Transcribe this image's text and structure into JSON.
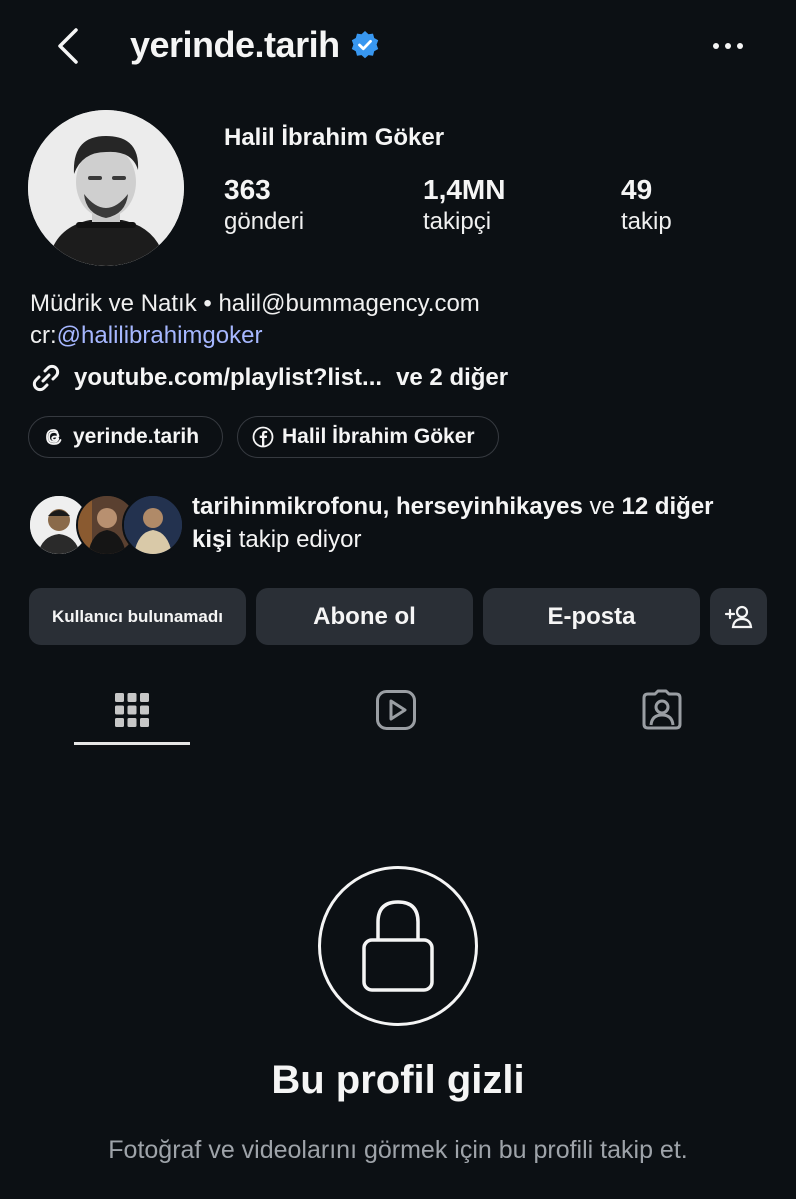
{
  "header": {
    "username": "yerinde.tarih",
    "verified": true,
    "icons": {
      "back": "chevron-left-icon",
      "verified": "verified-badge-icon",
      "more": "more-horizontal-icon"
    }
  },
  "profile": {
    "display_name": "Halil İbrahim Göker",
    "stats": [
      {
        "value": "363",
        "label": "gönderi"
      },
      {
        "value": "1,4MN",
        "label": "takipçi"
      },
      {
        "value": "49",
        "label": "takip"
      }
    ],
    "bio_line1": "Müdrik ve Natık • halil@bummagency.com",
    "bio_prefix": "cr:",
    "bio_mention": "@halilibrahimgoker",
    "link_text": "youtube.com/playlist?list...",
    "link_more": "ve 2 diğer",
    "chips": [
      {
        "icon": "threads-icon",
        "label": "yerinde.tarih"
      },
      {
        "icon": "facebook-icon",
        "label": "Halil İbrahim Göker"
      }
    ]
  },
  "mutual": {
    "names": "tarihinmikrofonu, herseyinhikayes",
    "and_word": " ve ",
    "count_text": "12 diğer",
    "line2_bold": "kişi",
    "line2_rest": " takip ediyor"
  },
  "actions": {
    "user_not_found": "Kullanıcı bulunamadı",
    "subscribe": "Abone ol",
    "email": "E-posta",
    "add_user_icon": "person-add-icon"
  },
  "tabs": [
    {
      "name": "grid",
      "icon": "grid-icon",
      "active": true
    },
    {
      "name": "reels",
      "icon": "reels-play-icon",
      "active": false
    },
    {
      "name": "tagged",
      "icon": "tagged-person-icon",
      "active": false
    }
  ],
  "private": {
    "icon": "lock-icon",
    "title": "Bu profil gizli",
    "subtitle": "Fotoğraf ve videolarını görmek için bu profili takip et."
  },
  "colors": {
    "background": "#0c1014",
    "button": "#2a2f36",
    "mention": "#a6b7ff",
    "verified": "#3897f0",
    "muted": "#9ea3a9"
  }
}
